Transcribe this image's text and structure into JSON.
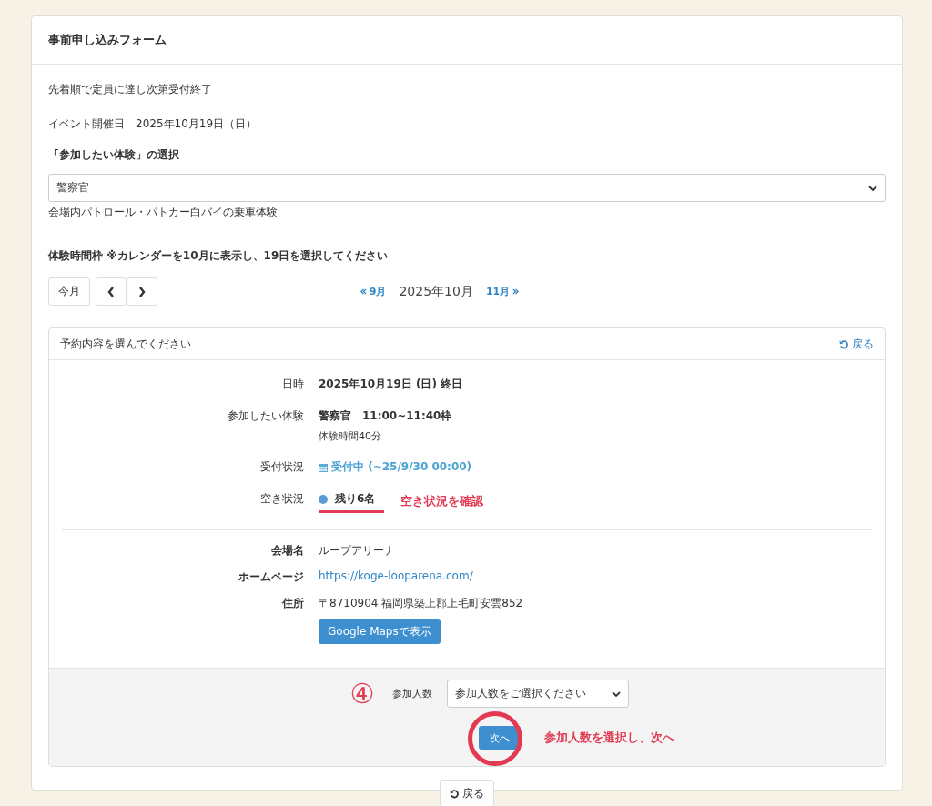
{
  "form": {
    "title": "事前申し込みフォーム",
    "notice": "先着順で定員に達し次第受付終了",
    "event_date": "イベント開催日　2025年10月19日（日）",
    "experience_label": "「参加したい体験」の選択",
    "experience_select": {
      "value": "警察官"
    },
    "experience_description": "会場内パトロール・パトカー白バイの乗車体験",
    "timeslot_label": "体験時間枠 ※カレンダーを10月に表示し、19日を選択してください",
    "calendar": {
      "today_button": "今月",
      "prev_month": "9月",
      "current_month": "2025年10月",
      "next_month": "11月"
    },
    "panel": {
      "title": "予約内容を選んでください",
      "back_link": "戻る",
      "schedule_rows": [
        {
          "kind": "bold",
          "label": "日時",
          "value": "2025年10月19日 (日) 終日"
        },
        {
          "kind": "bold",
          "label": "参加したい体験",
          "value": "警察官　11:00~11:40枠",
          "note": "体験時間40分"
        },
        {
          "kind": "status",
          "label": "受付状況",
          "value": "受付中 (~25/9/30 00:00)"
        },
        {
          "kind": "availability",
          "label": "空き状況",
          "value": "残り6名",
          "annotation": "空き状況を確認"
        }
      ],
      "venue_rows": [
        {
          "kind": "text",
          "label": "会場名",
          "value": "ループアリーナ"
        },
        {
          "kind": "link",
          "label": "ホームページ",
          "value": "https://koge-looparena.com/"
        },
        {
          "kind": "address",
          "label": "住所",
          "value": "〒8710904 福岡県築上郡上毛町安雲852",
          "button": "Google Mapsで表示"
        }
      ],
      "footer": {
        "step_marker": "④",
        "participants_label": "参加人数",
        "participants_select": {
          "placeholder": "参加人数をご選択ください"
        },
        "next_button": "次へ",
        "annotation": "参加人数を選択し、次へ"
      }
    },
    "back_button": "戻る"
  }
}
